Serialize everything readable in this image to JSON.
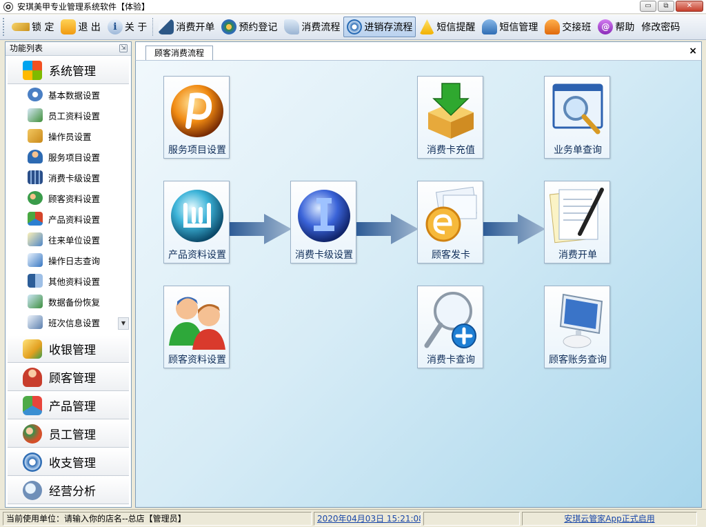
{
  "window": {
    "title": "安琪美甲专业管理系统软件【体验】",
    "minimize": "▭",
    "restore": "⧉",
    "close": "✕"
  },
  "toolbar": {
    "buttons": [
      {
        "label": "锁 定",
        "icon": "key-icon"
      },
      {
        "label": "退 出",
        "icon": "power-icon"
      },
      {
        "label": "关 于",
        "icon": "info-icon"
      },
      {
        "label": "消费开单",
        "icon": "bill-icon"
      },
      {
        "label": "预约登记",
        "icon": "book-icon"
      },
      {
        "label": "消费流程",
        "icon": "flow-icon"
      },
      {
        "label": "进销存流程",
        "icon": "cycle-icon"
      },
      {
        "label": "短信提醒",
        "icon": "warning-icon"
      },
      {
        "label": "短信管理",
        "icon": "people-icon"
      },
      {
        "label": "交接班",
        "icon": "shift-icon"
      },
      {
        "label": "帮助",
        "icon": "help-icon"
      },
      {
        "label": "修改密码",
        "icon": "password-icon"
      }
    ],
    "info_glyph": "i",
    "help_glyph": "@"
  },
  "sidebar": {
    "title": "功能列表",
    "pin": "⇲",
    "active_group": "系统管理",
    "items": [
      {
        "label": "基本数据设置",
        "icon": "gear-icon",
        "color": "#4a7fc4"
      },
      {
        "label": "员工资料设置",
        "icon": "pen-icon",
        "color": "#3f8f3a"
      },
      {
        "label": "操作员设置",
        "icon": "tools-icon",
        "color": "#c9891a"
      },
      {
        "label": "服务项目设置",
        "icon": "user-icon",
        "color": "#2d6ab2"
      },
      {
        "label": "消费卡级设置",
        "icon": "grid-icon",
        "color": "#2a4f8a"
      },
      {
        "label": "顾客资料设置",
        "icon": "group-icon",
        "color": "#3a9c4a"
      },
      {
        "label": "产品资料设置",
        "icon": "cubes-icon",
        "color": "#d4452a"
      },
      {
        "label": "往来单位设置",
        "icon": "note-icon",
        "color": "#4f86c6"
      },
      {
        "label": "操作日志查询",
        "icon": "log-icon",
        "color": "#3776c2"
      },
      {
        "label": "其他资料设置",
        "icon": "book-icon",
        "color": "#2c5d98"
      },
      {
        "label": "数据备份恢复",
        "icon": "backup-icon",
        "color": "#3d8f3f"
      },
      {
        "label": "班次信息设置",
        "icon": "shift-info-icon",
        "color": "#5b7fae"
      }
    ],
    "scroll_glyph": "▼",
    "groups": [
      {
        "label": "收银管理",
        "icon": "cash-icon",
        "color": "#e2a020"
      },
      {
        "label": "顾客管理",
        "icon": "customer-icon",
        "color": "#c83d2c"
      },
      {
        "label": "产品管理",
        "icon": "product-icon",
        "color": "#3a8fd2"
      },
      {
        "label": "员工管理",
        "icon": "staff-icon",
        "color": "#d4502a"
      },
      {
        "label": "收支管理",
        "icon": "finance-icon",
        "color": "#2f6db4"
      },
      {
        "label": "经营分析",
        "icon": "analysis-icon",
        "color": "#6f8fb8"
      }
    ]
  },
  "main": {
    "tab": "顾客消费流程",
    "tab_close": "×",
    "tiles": [
      {
        "label": "服务项目设置",
        "icon": "service-icon"
      },
      {
        "label": "消费卡充值",
        "icon": "recharge-icon"
      },
      {
        "label": "业务单查询",
        "icon": "business-query-icon"
      },
      {
        "label": "产品资料设置",
        "icon": "product-settings-icon"
      },
      {
        "label": "消费卡级设置",
        "icon": "card-level-icon"
      },
      {
        "label": "顾客发卡",
        "icon": "issue-card-icon"
      },
      {
        "label": "消费开单",
        "icon": "billing-icon"
      },
      {
        "label": "顾客资料设置",
        "icon": "customer-info-icon"
      },
      {
        "label": "消费卡查询",
        "icon": "card-query-icon"
      },
      {
        "label": "顾客账务查询",
        "icon": "account-query-icon"
      }
    ]
  },
  "status": {
    "unit": "当前使用单位：请输入你的店名--总店【管理员】",
    "datetime": "2020年04月03日   15:21:08",
    "notice": "安琪云管家App正式启用"
  }
}
